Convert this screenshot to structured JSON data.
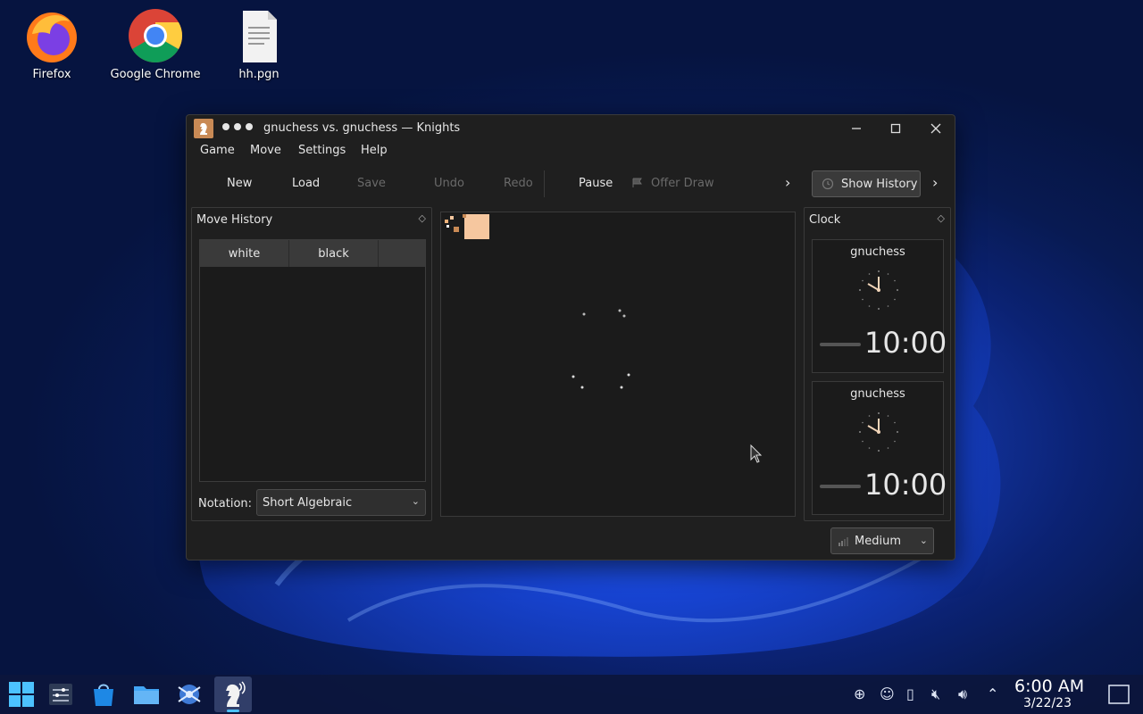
{
  "desktop": {
    "icons": [
      {
        "label": "Firefox"
      },
      {
        "label": "Google Chrome"
      },
      {
        "label": "hh.pgn"
      }
    ]
  },
  "window": {
    "title": "gnuchess vs. gnuchess — Knights",
    "menu": [
      "Game",
      "Move",
      "Settings",
      "Help"
    ],
    "toolbar": {
      "new": "New",
      "load": "Load",
      "save": "Save",
      "undo": "Undo",
      "redo": "Redo",
      "pause": "Pause",
      "offer_draw": "Offer Draw",
      "show_history": "Show History"
    },
    "move_history": {
      "title": "Move History",
      "columns": [
        "white",
        "black"
      ],
      "notation_label": "Notation:",
      "notation_value": "Short Algebraic"
    },
    "clock": {
      "title": "Clock",
      "players": [
        {
          "name": "gnuchess",
          "time": "10:00"
        },
        {
          "name": "gnuchess",
          "time": "10:00"
        }
      ]
    },
    "difficulty": "Medium"
  },
  "taskbar": {
    "time": "6:00 AM",
    "date": "3/22/23"
  },
  "colors": {
    "accent": "#1d4fd6",
    "window_bg": "#1f1f1f"
  }
}
